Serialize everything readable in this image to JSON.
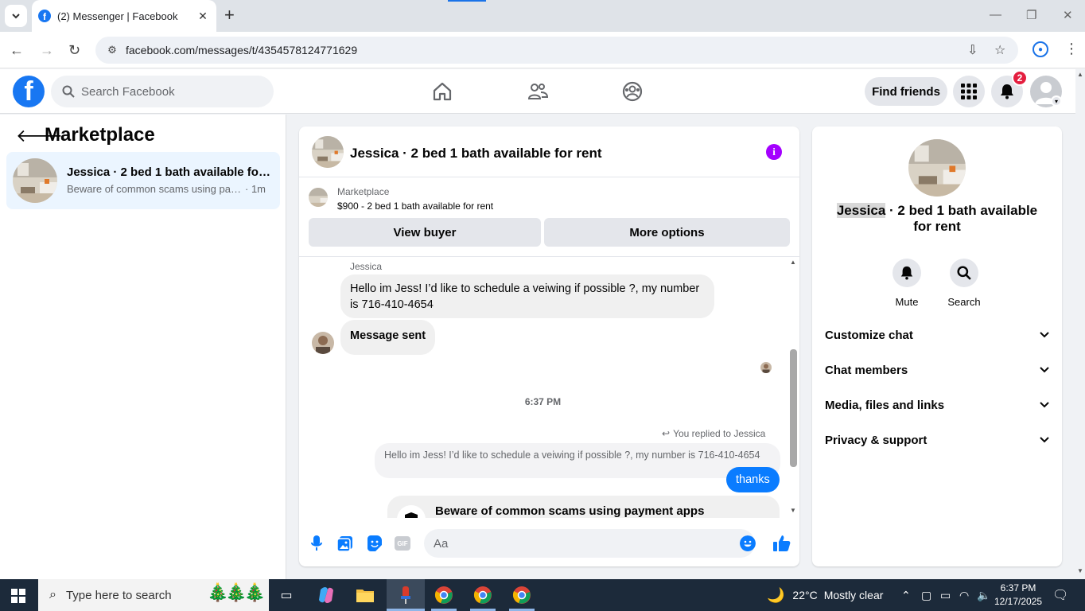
{
  "browser": {
    "tab_title": "(2) Messenger | Facebook",
    "url": "facebook.com/messages/t/4354578124771629"
  },
  "fb_header": {
    "search_placeholder": "Search Facebook",
    "find_friends_label": "Find friends",
    "notification_count": "2",
    "icons": [
      "home-icon",
      "friends-icon",
      "groups-icon",
      "menu-grid-icon",
      "bell-icon",
      "profile-avatar"
    ]
  },
  "sidebar": {
    "title": "Marketplace",
    "conversation": {
      "name": "Jessica · 2 bed 1 bath available for ...",
      "preview": "Beware of common scams using pay...",
      "time": "· 1m"
    }
  },
  "chat": {
    "title": "Jessica · 2 bed 1 bath available for rent",
    "listing": {
      "source": "Marketplace",
      "price_title": "$900 - 2 bed 1 bath available for rent",
      "view_buyer_label": "View buyer",
      "more_options_label": "More options"
    },
    "messages": {
      "sender_name": "Jessica",
      "incoming_1": "Hello im Jess! I’d like to schedule a veiwing if possible ?, my number is 716-410-4654",
      "incoming_2": "Message sent",
      "timestamp": "6:37 PM",
      "reply_note": "You replied to Jessica",
      "reply_quote": "Hello im Jess! I’d like to schedule a veiwing if possible ?, my number is 716-410-4654",
      "outgoing": "thanks",
      "scam_title": "Beware of common scams using payment apps"
    },
    "composer": {
      "placeholder": "Aa",
      "gif_label": "GIF"
    }
  },
  "info_panel": {
    "title_name": "Jessica",
    "title_rest": " · 2 bed 1 bath available for rent",
    "mute_label": "Mute",
    "search_label": "Search",
    "sections": [
      "Customize chat",
      "Chat members",
      "Media, files and links",
      "Privacy & support"
    ]
  },
  "taskbar": {
    "search_placeholder": "Type here to search",
    "weather_temp": "22°C",
    "weather_text": "Mostly clear",
    "time": "6:37 PM",
    "date": "12/17/2025"
  },
  "colors": {
    "fb_blue": "#1877f2",
    "messenger_blue": "#0a7cff",
    "info_purple": "#a400ff",
    "badge_red": "#e41e3f"
  }
}
